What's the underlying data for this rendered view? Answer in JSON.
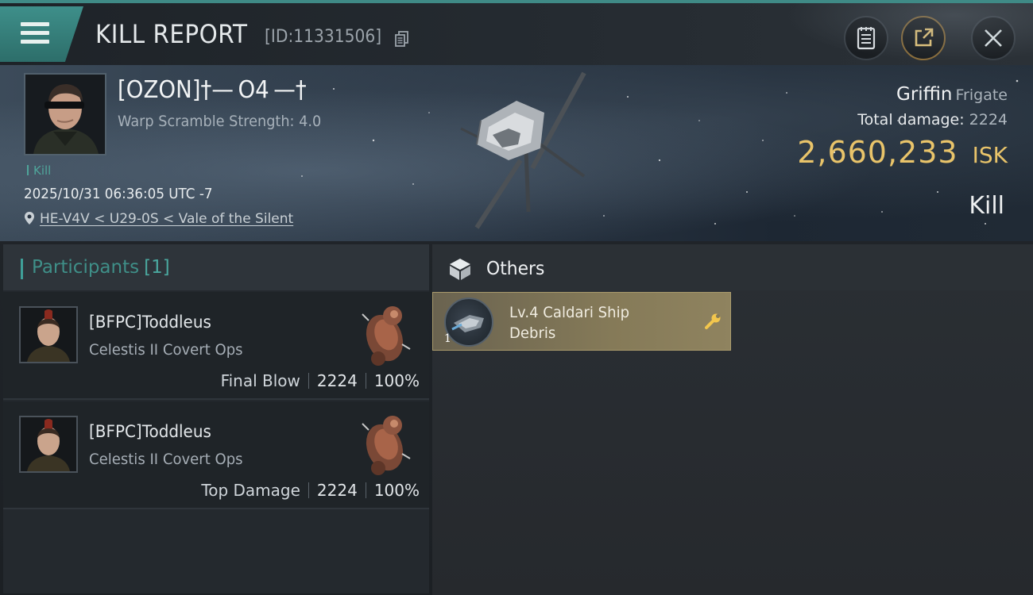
{
  "header": {
    "title": "KILL REPORT",
    "report_id": "[ID:11331506]"
  },
  "victim": {
    "name": "[OZON]†— O4 —†",
    "warp_scramble": "Warp Scramble Strength: 4.0",
    "tag": "Kill",
    "datetime": "2025/10/31 06:36:05 UTC -7",
    "location": "HE-V4V < U29-0S < Vale of the Silent",
    "ship_name": "Griffin",
    "ship_class": "Frigate",
    "total_damage_label": "Total damage:",
    "total_damage": "2224",
    "isk_value": "2,660,233",
    "isk_unit": "ISK",
    "result": "Kill"
  },
  "participants": {
    "title": "Participants",
    "count": "[1]",
    "rows": [
      {
        "name": "[BFPC]Toddleus",
        "ship": "Celestis II Covert Ops",
        "role": "Final Blow",
        "damage": "2224",
        "percent": "100%"
      },
      {
        "name": "[BFPC]Toddleus",
        "ship": "Celestis II Covert Ops",
        "role": "Top Damage",
        "damage": "2224",
        "percent": "100%"
      }
    ]
  },
  "others": {
    "title": "Others",
    "items": [
      {
        "name": "Lv.4 Caldari Ship Debris",
        "quantity": "1"
      }
    ]
  },
  "colors": {
    "accent_teal": "#3f9f98",
    "isk_gold": "#e9c46a",
    "loot_gold": "#857a58"
  }
}
